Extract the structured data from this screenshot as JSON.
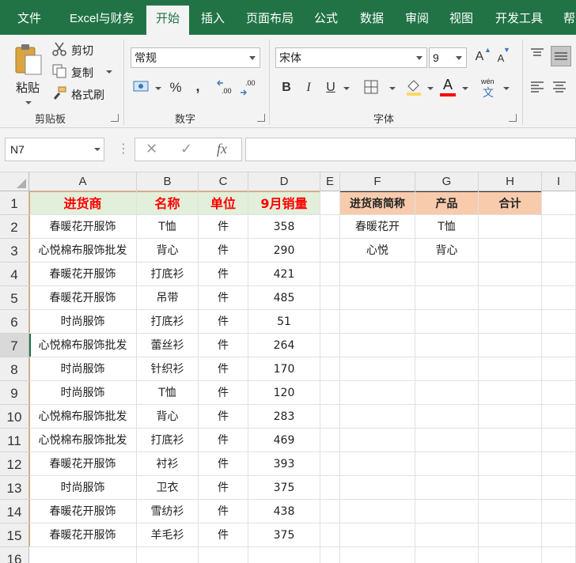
{
  "tabs": [
    "文件",
    "Excel与财务",
    "开始",
    "插入",
    "页面布局",
    "公式",
    "数据",
    "审阅",
    "视图",
    "开发工具",
    "帮"
  ],
  "active_tab": "开始",
  "clipboard": {
    "paste": "粘贴",
    "cut": "剪切",
    "copy": "复制",
    "format_painter": "格式刷",
    "group": "剪贴板"
  },
  "number": {
    "format": "常规",
    "percent": "%",
    "comma": ",",
    "inc_decimal": ".00",
    "dec_decimal": ".00",
    "group": "数字"
  },
  "font": {
    "name": "宋体",
    "size": "9",
    "bold": "B",
    "italic": "I",
    "underline": "U",
    "grow": "A",
    "shrink": "A",
    "wen": "wén",
    "wen_char": "文",
    "group": "字体"
  },
  "formula_bar": {
    "name_box": "N7",
    "fx": "fx",
    "value": ""
  },
  "columns": [
    "A",
    "B",
    "C",
    "D",
    "E",
    "F",
    "G",
    "H",
    "I"
  ],
  "rows": [
    "1",
    "2",
    "3",
    "4",
    "5",
    "6",
    "7",
    "8",
    "9",
    "10",
    "11",
    "12",
    "13",
    "14",
    "15",
    "16"
  ],
  "table1": {
    "headers": [
      "进货商",
      "名称",
      "单位",
      "9月销量"
    ],
    "rows": [
      [
        "春暖花开服饰",
        "T恤",
        "件",
        "358"
      ],
      [
        "心悦棉布服饰批发",
        "背心",
        "件",
        "290"
      ],
      [
        "春暖花开服饰",
        "打底衫",
        "件",
        "421"
      ],
      [
        "春暖花开服饰",
        "吊带",
        "件",
        "485"
      ],
      [
        "时尚服饰",
        "打底衫",
        "件",
        "51"
      ],
      [
        "心悦棉布服饰批发",
        "蕾丝衫",
        "件",
        "264"
      ],
      [
        "时尚服饰",
        "针织衫",
        "件",
        "170"
      ],
      [
        "时尚服饰",
        "T恤",
        "件",
        "120"
      ],
      [
        "心悦棉布服饰批发",
        "背心",
        "件",
        "283"
      ],
      [
        "心悦棉布服饰批发",
        "打底衫",
        "件",
        "469"
      ],
      [
        "春暖花开服饰",
        "衬衫",
        "件",
        "393"
      ],
      [
        "时尚服饰",
        "卫衣",
        "件",
        "375"
      ],
      [
        "春暖花开服饰",
        "雪纺衫",
        "件",
        "438"
      ],
      [
        "春暖花开服饰",
        "羊毛衫",
        "件",
        "375"
      ]
    ]
  },
  "table2": {
    "headers": [
      "进货商简称",
      "产品",
      "合计"
    ],
    "rows": [
      [
        "春暖花开",
        "T恤",
        ""
      ],
      [
        "心悦",
        "背心",
        ""
      ]
    ]
  },
  "colors": {
    "excel_green": "#217346",
    "header_green_fill": "#e2efda",
    "header_red_text": "#ff0000",
    "header_peach_fill": "#f8cbad",
    "border_orange": "#e9a25a"
  }
}
